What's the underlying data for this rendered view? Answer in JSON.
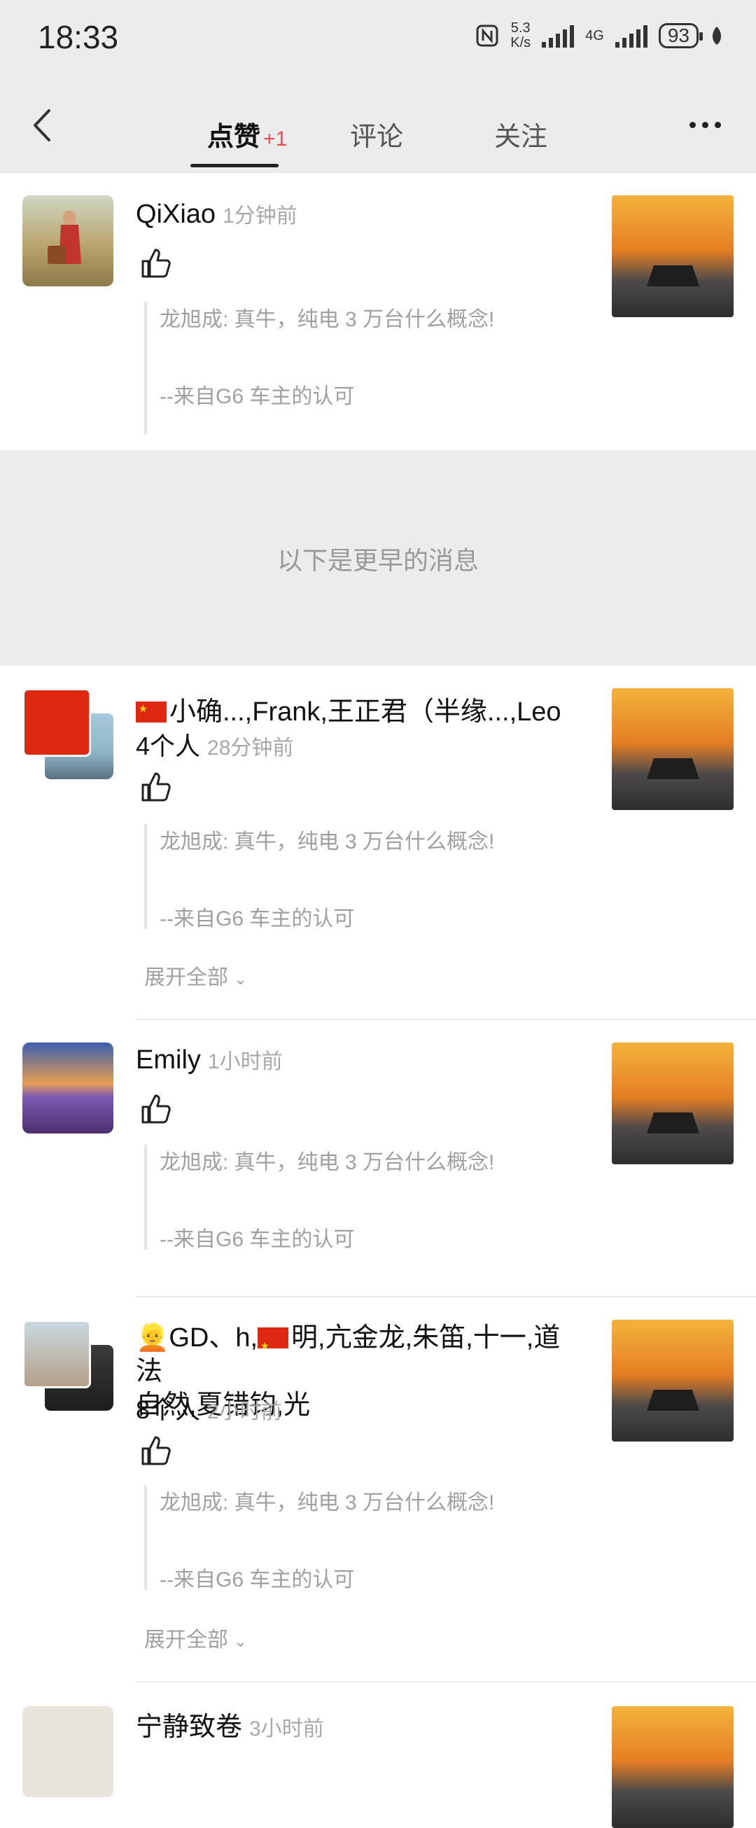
{
  "status_bar": {
    "time": "18:33",
    "net_speed_top": "5.3",
    "net_speed_bottom": "K/s",
    "signal_label": "4G",
    "battery": "93"
  },
  "nav": {
    "tabs": [
      {
        "label": "点赞",
        "badge": "+1"
      },
      {
        "label": "评论"
      },
      {
        "label": "关注"
      }
    ]
  },
  "divider_text": "以下是更早的消息",
  "items": [
    {
      "name": "QiXiao",
      "time": "1分钟前",
      "quote_line1": "龙旭成: 真牛，纯电 3 万台什么概念!",
      "quote_line2": "--来自G6 车主的认可"
    },
    {
      "name": "小确...,Frank,王正君（半缘...,Leo",
      "count": "4个人",
      "time": "28分钟前",
      "quote_line1": "龙旭成: 真牛，纯电 3 万台什么概念!",
      "quote_line2": "--来自G6 车主的认可",
      "expand": "展开全部"
    },
    {
      "name": "Emily",
      "time": "1小时前",
      "quote_line1": "龙旭成: 真牛，纯电 3 万台什么概念!",
      "quote_line2": "--来自G6 车主的认可"
    },
    {
      "name_line1": "GD、h,",
      "name_line1b": "明,亢金龙,朱笛,十一,道法",
      "name_line2": "自然,夏错钧,光",
      "count": "8个人",
      "time": "2小时前",
      "quote_line1": "龙旭成: 真牛，纯电 3 万台什么概念!",
      "quote_line2": "--来自G6 车主的认可",
      "expand": "展开全部"
    },
    {
      "name": "宁静致卷",
      "time": "3小时前"
    }
  ],
  "colors": {
    "badge_red": "#f04a4a",
    "bg_gray": "#ececec",
    "muted": "#a0a0a0"
  }
}
